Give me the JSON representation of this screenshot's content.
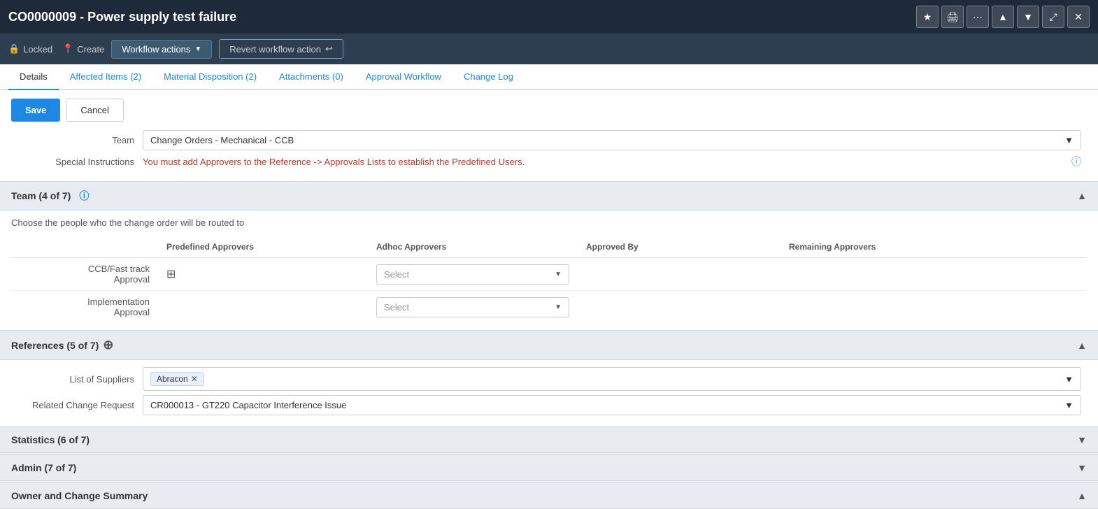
{
  "titleBar": {
    "title": "CO0000009 - Power supply test failure",
    "icons": [
      "star",
      "print",
      "more",
      "up",
      "down",
      "expand",
      "close"
    ]
  },
  "toolbar": {
    "locked_label": "Locked",
    "create_label": "Create",
    "workflow_actions_label": "Workflow actions",
    "revert_workflow_label": "Revert workflow action"
  },
  "tabs": [
    {
      "label": "Details",
      "active": true
    },
    {
      "label": "Affected Items (2)",
      "active": false
    },
    {
      "label": "Material Disposition (2)",
      "active": false
    },
    {
      "label": "Attachments (0)",
      "active": false
    },
    {
      "label": "Approval Workflow",
      "active": false
    },
    {
      "label": "Change Log",
      "active": false
    }
  ],
  "actions": {
    "save_label": "Save",
    "cancel_label": "Cancel"
  },
  "form": {
    "team_label": "Team",
    "team_value": "Change Orders - Mechanical - CCB",
    "special_instructions_label": "Special Instructions",
    "special_instructions_text": "You must add Approvers to the Reference -> Approvals Lists to establish the Predefined Users."
  },
  "teamSection": {
    "title": "Team (4 of 7)",
    "description": "Choose the people who the change order will be routed to",
    "columns": {
      "predefined": "Predefined Approvers",
      "adhoc": "Adhoc Approvers",
      "approved_by": "Approved By",
      "remaining": "Remaining Approvers"
    },
    "rows": [
      {
        "label": "CCB/Fast track\nApproval",
        "adhoc_placeholder": "Select",
        "approved_by": "",
        "remaining": ""
      },
      {
        "label": "Implementation\nApproval",
        "adhoc_placeholder": "Select",
        "approved_by": "",
        "remaining": ""
      }
    ]
  },
  "referencesSection": {
    "title": "References (5 of 7)",
    "list_of_suppliers_label": "List of Suppliers",
    "supplier_tag": "Abracon",
    "related_change_request_label": "Related Change Request",
    "related_change_request_value": "CR000013 - GT220 Capacitor Interference Issue"
  },
  "statisticsSection": {
    "title": "Statistics (6 of 7)"
  },
  "adminSection": {
    "title": "Admin (7 of 7)"
  },
  "ownerSection": {
    "title": "Owner and Change Summary"
  }
}
